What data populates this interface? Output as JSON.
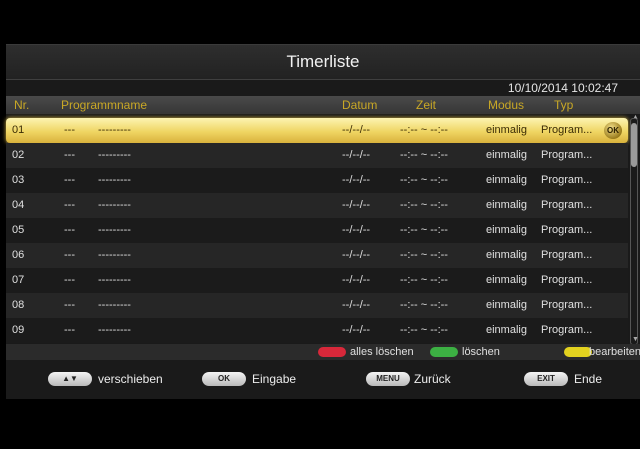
{
  "title": "Timerliste",
  "datetime": "10/10/2014 10:02:47",
  "columns": {
    "nr": "Nr.",
    "programmname": "Programmname",
    "datum": "Datum",
    "zeit": "Zeit",
    "modus": "Modus",
    "typ": "Typ"
  },
  "rows": [
    {
      "nr": "01",
      "prog_nr": "---",
      "name": "---------",
      "datum": "--/--/--",
      "zeit": "--:-- ~ --:--",
      "modus": "einmalig",
      "typ": "Program..."
    },
    {
      "nr": "02",
      "prog_nr": "---",
      "name": "---------",
      "datum": "--/--/--",
      "zeit": "--:-- ~ --:--",
      "modus": "einmalig",
      "typ": "Program..."
    },
    {
      "nr": "03",
      "prog_nr": "---",
      "name": "---------",
      "datum": "--/--/--",
      "zeit": "--:-- ~ --:--",
      "modus": "einmalig",
      "typ": "Program..."
    },
    {
      "nr": "04",
      "prog_nr": "---",
      "name": "---------",
      "datum": "--/--/--",
      "zeit": "--:-- ~ --:--",
      "modus": "einmalig",
      "typ": "Program..."
    },
    {
      "nr": "05",
      "prog_nr": "---",
      "name": "---------",
      "datum": "--/--/--",
      "zeit": "--:-- ~ --:--",
      "modus": "einmalig",
      "typ": "Program..."
    },
    {
      "nr": "06",
      "prog_nr": "---",
      "name": "---------",
      "datum": "--/--/--",
      "zeit": "--:-- ~ --:--",
      "modus": "einmalig",
      "typ": "Program..."
    },
    {
      "nr": "07",
      "prog_nr": "---",
      "name": "---------",
      "datum": "--/--/--",
      "zeit": "--:-- ~ --:--",
      "modus": "einmalig",
      "typ": "Program..."
    },
    {
      "nr": "08",
      "prog_nr": "---",
      "name": "---------",
      "datum": "--/--/--",
      "zeit": "--:-- ~ --:--",
      "modus": "einmalig",
      "typ": "Program..."
    },
    {
      "nr": "09",
      "prog_nr": "---",
      "name": "---------",
      "datum": "--/--/--",
      "zeit": "--:-- ~ --:--",
      "modus": "einmalig",
      "typ": "Program..."
    }
  ],
  "selected_index": 0,
  "ok_badge": "OK",
  "color_actions": [
    {
      "color": "#d8283a",
      "label": "alles löschen"
    },
    {
      "color": "#3cb043",
      "label": "löschen"
    },
    {
      "color": "#e3d21f",
      "label": "bearbeiten"
    }
  ],
  "nav": {
    "move_key": "▲▼",
    "move_label": "verschieben",
    "ok_key": "OK",
    "ok_label": "Eingabe",
    "menu_key": "MENU",
    "menu_label": "Zurück",
    "exit_key": "EXIT",
    "exit_label": "Ende"
  }
}
